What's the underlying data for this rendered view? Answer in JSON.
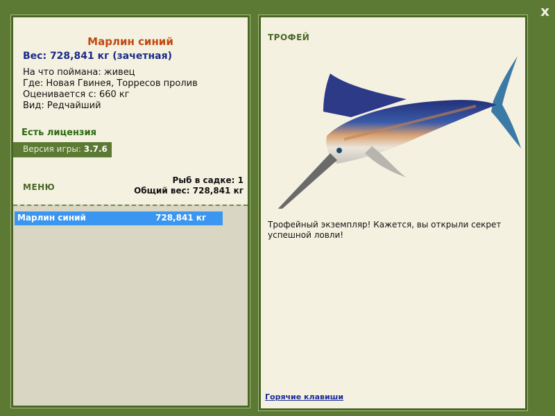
{
  "window": {
    "close_label": "x"
  },
  "fish": {
    "title": "Марлин синий",
    "weight_line": "Вес: 728,841 кг (зачетная)",
    "details": [
      "На что поймана: живец",
      "Где: Новая Гвинея, Торресов пролив",
      "Оценивается с: 660 кг",
      "Вид: Редчайший"
    ]
  },
  "license": "Есть лицензия",
  "version": {
    "label": "Версия игры: ",
    "value": "3.7.6"
  },
  "menu_label": "МЕНЮ",
  "stats": {
    "count_line": "Рыб в садке: 1",
    "total_line": "Общий вес: 728,841 кг"
  },
  "catch_list": [
    {
      "name": "Марлин синий",
      "weight": "728,841 кг"
    }
  ],
  "trophy": {
    "label": "ТРОФЕЙ",
    "text": "Трофейный экземпляр! Кажется, вы открыли секрет успешной ловли!"
  },
  "hotkeys_label": "Горячие клавиши"
}
